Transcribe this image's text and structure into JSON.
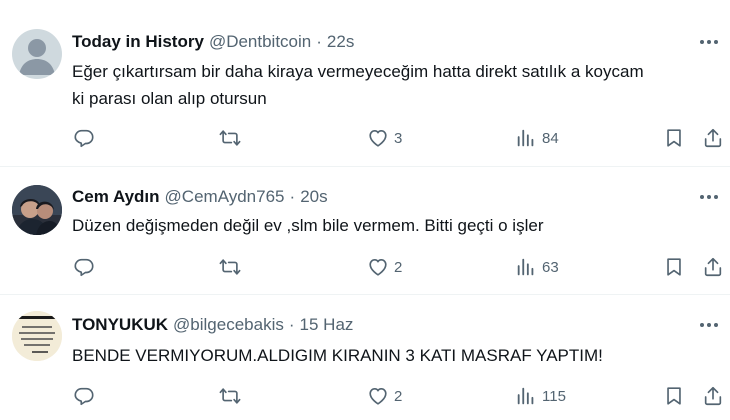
{
  "tweets": [
    {
      "name": "Today in History",
      "handle": "@Dentbitcoin",
      "separator": "·",
      "time": "22s",
      "text_lines": [
        "Eğer çıkartırsam bir daha kiraya vermeyeceğim hatta direkt satılık a koycam",
        "ki parası olan alıp otursun"
      ],
      "reply_count": "",
      "retweet_count": "",
      "like_count": "3",
      "view_count": "84"
    },
    {
      "name": "Cem Aydın",
      "handle": "@CemAydn765",
      "separator": "·",
      "time": "20s",
      "text_lines": [
        "Düzen değişmeden değil ev ,slm bile vermem. Bitti geçti o işler"
      ],
      "reply_count": "",
      "retweet_count": "",
      "like_count": "2",
      "view_count": "63"
    },
    {
      "name": "TONYUKUK",
      "handle": "@bilgecebakis",
      "separator": "·",
      "time": "15 Haz",
      "text_lines": [
        "BENDE VERMIYORUM.ALDIGIM KIRANIN 3 KATI MASRAF YAPTIM!"
      ],
      "reply_count": "",
      "retweet_count": "",
      "like_count": "2",
      "view_count": "115"
    }
  ],
  "icons": {
    "reply": "reply-icon",
    "retweet": "retweet-icon",
    "like": "heart-icon",
    "views": "views-icon",
    "bookmark": "bookmark-icon",
    "share": "share-icon",
    "more": "more-icon"
  },
  "colors": {
    "text": "#0f1419",
    "secondary": "#536471",
    "divider": "#eff3f4"
  }
}
